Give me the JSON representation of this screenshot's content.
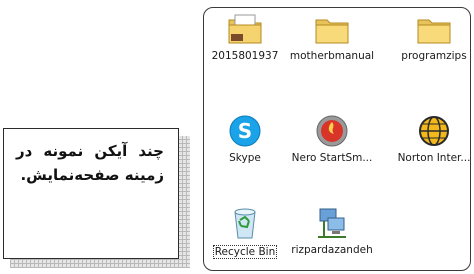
{
  "caption": {
    "text": "چند آیکن نمونه در زمینه صفحه‌نمایش."
  },
  "desktop": {
    "icons": [
      {
        "label": "2015801937",
        "icon": "folder-with-document-icon"
      },
      {
        "label": "motherbmanual",
        "icon": "folder-icon"
      },
      {
        "label": "programzips",
        "icon": "folder-icon"
      },
      {
        "label": "Skype",
        "icon": "skype-icon"
      },
      {
        "label": "Nero StartSm...",
        "icon": "nero-icon"
      },
      {
        "label": "Norton Inter...",
        "icon": "norton-globe-icon"
      },
      {
        "label": "Recycle Bin",
        "icon": "recycle-bin-icon"
      },
      {
        "label": "rizpardazandeh",
        "icon": "network-computer-icon"
      }
    ]
  }
}
